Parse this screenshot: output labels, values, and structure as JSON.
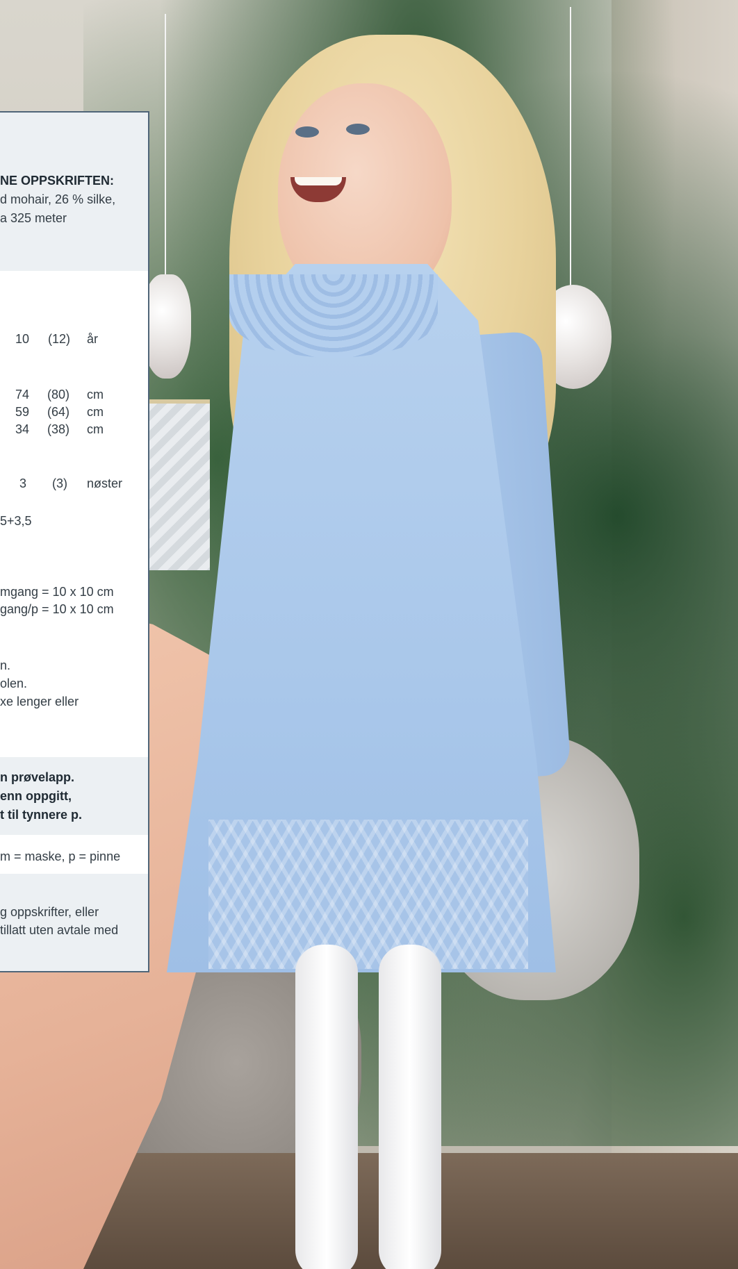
{
  "materials": {
    "heading": "NE OPPSKRIFTEN:",
    "line1": "d mohair, 26 % silke,",
    "line2": "a 325 meter"
  },
  "sizes": {
    "row": {
      "v1": "10",
      "v2": "(12)",
      "unit": "år"
    }
  },
  "measurements": [
    {
      "v1": "74",
      "v2": "(80)",
      "unit": "cm"
    },
    {
      "v1": "59",
      "v2": "(64)",
      "unit": "cm"
    },
    {
      "v1": "34",
      "v2": "(38)",
      "unit": "cm"
    }
  ],
  "yarn_amount": {
    "v1": "3",
    "v2": "(3)",
    "unit": "nøster"
  },
  "needles": "5+3,5",
  "gauge": {
    "line1": "mgang = 10 x 10 cm",
    "line2": "gang/p = 10 x 10 cm"
  },
  "notes": {
    "line1": "n.",
    "line2": "olen.",
    "line3": "xe lenger eller"
  },
  "warning": {
    "line1": "n prøvelapp.",
    "line2": "enn oppgitt,",
    "line3": "t til tynnere p."
  },
  "abbreviations": "m = maske, p =  pinne",
  "copyright": {
    "line1": "g oppskrifter, eller",
    "line2": "tillatt uten avtale med"
  }
}
